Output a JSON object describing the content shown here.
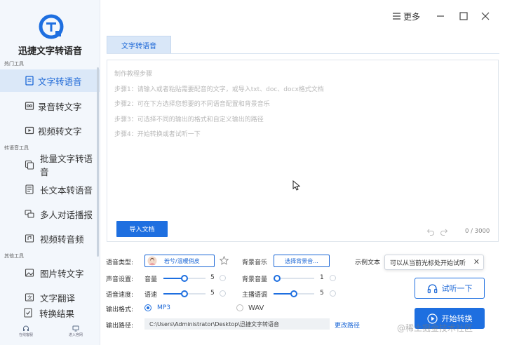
{
  "app": {
    "name": "迅捷文字转语音",
    "brand_color": "#1e6fe0"
  },
  "window": {
    "more_label": "更多",
    "minimize_icon": "minimize-icon",
    "maximize_icon": "maximize-icon",
    "close_icon": "close-icon"
  },
  "sidebar": {
    "sections": {
      "hot": "热门工具",
      "convert": "转语音工具",
      "other": "其他工具"
    },
    "items": [
      {
        "label": "文字转语音",
        "icon": "document-icon",
        "active": true
      },
      {
        "label": "录音转文字",
        "icon": "recorder-icon"
      },
      {
        "label": "视频转文字",
        "icon": "video-icon"
      },
      {
        "label": "批量文字转语音",
        "icon": "batch-icon"
      },
      {
        "label": "长文本转语音",
        "icon": "long-text-icon"
      },
      {
        "label": "多人对话播报",
        "icon": "dialog-icon"
      },
      {
        "label": "视频转音频",
        "icon": "video-audio-icon"
      },
      {
        "label": "图片转文字",
        "icon": "image-icon"
      },
      {
        "label": "文字翻译",
        "icon": "translate-icon"
      },
      {
        "label": "转换结果",
        "icon": "result-icon"
      }
    ],
    "bottom": {
      "left_label": "在线客服",
      "right_label": "进入官网"
    }
  },
  "tab": {
    "label": "文字转语音"
  },
  "editor": {
    "hints": [
      "制作教程步骤",
      "步骤1：请输入或者粘贴需要配音的文字，或导入txt、doc、docx格式文档",
      "步骤2：可在下方选择您想要的不同语音配置和背景音乐",
      "步骤3：可选择不同的输出的格式和自定义输出的路径",
      "步骤4：开始转换或者试听一下"
    ],
    "import_label": "导入文档",
    "char_count": "0 / 3000"
  },
  "settings": {
    "voice_type_label": "语音类型:",
    "voice_name": "若兮/温暖俏皮",
    "bg_music_label": "背景音乐",
    "bg_music_button": "选择背景音...",
    "sample_text_label": "示例文本",
    "sound_label": "声音设置:",
    "volume_label": "音量",
    "volume_value": "5",
    "bg_volume_label": "背景音量",
    "bg_volume_value": "1",
    "speed_label": "语音速度:",
    "speed_sub": "语速",
    "speed_value": "5",
    "pitch_label": "主播语调",
    "pitch_value": "5",
    "format_label": "输出格式:",
    "format_mp3": "MP3",
    "format_wav": "WAV",
    "path_label": "输出路径:",
    "path_value": "C:\\Users\\Administrator\\Desktop\\迅捷文字转语音",
    "change_path": "更改路径",
    "volume_level": 0.5,
    "bg_volume_level": 0.02,
    "speed_level": 0.5,
    "pitch_level": 0.5
  },
  "tooltip": {
    "text": "可以从当前光标处开始试听"
  },
  "actions": {
    "listen_label": "试听一下",
    "convert_label": "开始转换"
  },
  "watermark": "@稀土掘金技术社区"
}
